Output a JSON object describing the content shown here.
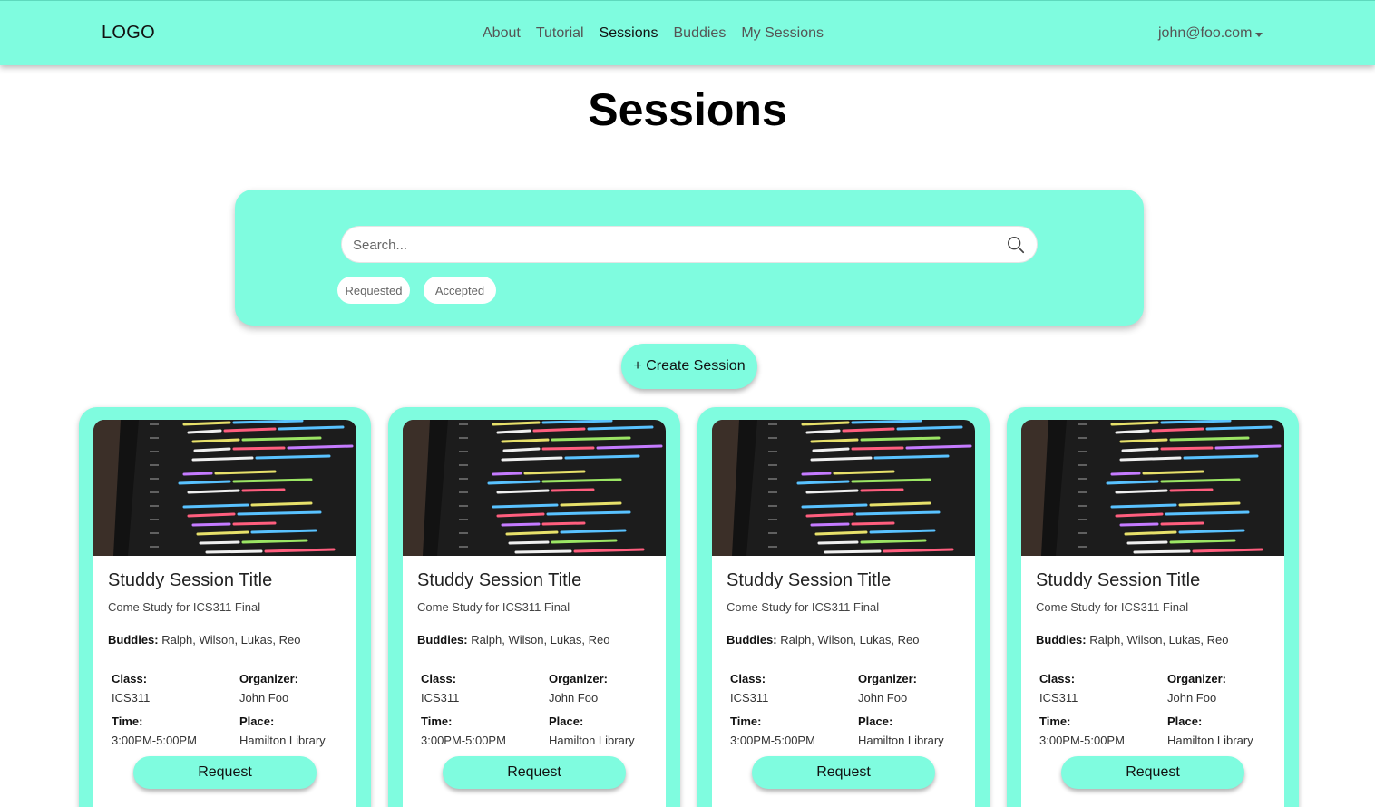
{
  "nav": {
    "logo": "LOGO",
    "links": [
      "About",
      "Tutorial",
      "Sessions",
      "Buddies",
      "My Sessions"
    ],
    "active": "Sessions",
    "user": "john@foo.com"
  },
  "page": {
    "title": "Sessions"
  },
  "search": {
    "placeholder": "Search...",
    "filters": [
      "Requested",
      "Accepted"
    ]
  },
  "create_button": "+ Create Session",
  "cards": [
    {
      "title": "Studdy Session Title",
      "subtitle": "Come Study for ICS311 Final",
      "buddies_label": "Buddies:",
      "buddies": "Ralph, Wilson, Lukas, Reo",
      "class_label": "Class:",
      "class": "ICS311",
      "organizer_label": "Organizer:",
      "organizer": "John Foo",
      "time_label": "Time:",
      "time": "3:00PM-5:00PM",
      "place_label": "Place:",
      "place": "Hamilton Library",
      "button": "Request"
    },
    {
      "title": "Studdy Session Title",
      "subtitle": "Come Study for ICS311 Final",
      "buddies_label": "Buddies:",
      "buddies": "Ralph, Wilson, Lukas, Reo",
      "class_label": "Class:",
      "class": "ICS311",
      "organizer_label": "Organizer:",
      "organizer": "John Foo",
      "time_label": "Time:",
      "time": "3:00PM-5:00PM",
      "place_label": "Place:",
      "place": "Hamilton Library",
      "button": "Request"
    },
    {
      "title": "Studdy Session Title",
      "subtitle": "Come Study for ICS311 Final",
      "buddies_label": "Buddies:",
      "buddies": "Ralph, Wilson, Lukas, Reo",
      "class_label": "Class:",
      "class": "ICS311",
      "organizer_label": "Organizer:",
      "organizer": "John Foo",
      "time_label": "Time:",
      "time": "3:00PM-5:00PM",
      "place_label": "Place:",
      "place": "Hamilton Library",
      "button": "Request"
    },
    {
      "title": "Studdy Session Title",
      "subtitle": "Come Study for ICS311 Final",
      "buddies_label": "Buddies:",
      "buddies": "Ralph, Wilson, Lukas, Reo",
      "class_label": "Class:",
      "class": "ICS311",
      "organizer_label": "Organizer:",
      "organizer": "John Foo",
      "time_label": "Time:",
      "time": "3:00PM-5:00PM",
      "place_label": "Place:",
      "place": "Hamilton Library",
      "button": "Request"
    }
  ],
  "colors": {
    "accent": "#7ffcdf",
    "background": "#ffffff"
  },
  "icons": {
    "search": "search-icon",
    "card_image": "code-screenshot-image"
  }
}
